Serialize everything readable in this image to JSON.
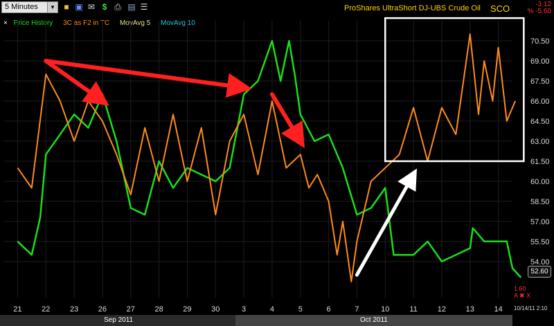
{
  "toolbar": {
    "interval": "5 Minutes",
    "icons": [
      "folder-icon",
      "save-icon",
      "mail-icon",
      "dollar-icon",
      "print-icon",
      "image-icon",
      "options-icon"
    ]
  },
  "header": {
    "title": "ProShares UltraShort DJ-UBS Crude Oil",
    "symbol": "SCO",
    "change": "-3.12",
    "change_pct": "% -5.60"
  },
  "legend": {
    "close": "×",
    "items": [
      {
        "label": "Price History",
        "color": "#19e019"
      },
      {
        "label": "3C as F2 in TC",
        "color": "#ff8c1a"
      },
      {
        "label": "MovAvg 5",
        "color": "#e8e08a"
      },
      {
        "label": "MovAvg 10",
        "color": "#20c8d8"
      }
    ]
  },
  "price_box": "52.60",
  "bottom_info": {
    "value": "1.60",
    "text": "A ✖ X"
  },
  "datestamp": "10/14/11 2:10",
  "months": [
    "Sep 2011",
    "Oct 2011"
  ],
  "colors": {
    "price": "#19e019",
    "indicator": "#ff8c1a",
    "annotation_red": "#ff2020",
    "annotation_white": "#ffffff"
  },
  "chart_data": {
    "type": "line",
    "x_labels": [
      "21",
      "22",
      "23",
      "26",
      "27",
      "28",
      "29",
      "30",
      "3",
      "4",
      "5",
      "6",
      "7",
      "10",
      "11",
      "12",
      "13",
      "14"
    ],
    "y_ticks": [
      "70.50",
      "69.00",
      "67.50",
      "66.00",
      "64.50",
      "63.00",
      "61.50",
      "60.00",
      "58.50",
      "57.00",
      "55.50",
      "54.00"
    ],
    "ylim": [
      51.3,
      72.0
    ],
    "series": [
      {
        "name": "Price History",
        "values": [
          [
            21,
            55.5
          ],
          [
            21.5,
            54.5
          ],
          [
            21.8,
            57.3
          ],
          [
            22,
            62.0
          ],
          [
            22.5,
            63.5
          ],
          [
            23,
            65.0
          ],
          [
            23.5,
            64.0
          ],
          [
            26,
            66.5
          ],
          [
            26.5,
            63.0
          ],
          [
            27,
            58.0
          ],
          [
            27.5,
            57.5
          ],
          [
            28,
            61.5
          ],
          [
            28.5,
            59.5
          ],
          [
            29,
            61.0
          ],
          [
            29.5,
            60.5
          ],
          [
            30,
            60.0
          ],
          [
            30.5,
            61.0
          ],
          [
            3,
            66.5
          ],
          [
            3.5,
            67.5
          ],
          [
            4,
            70.5
          ],
          [
            4.3,
            67.5
          ],
          [
            4.6,
            70.5
          ],
          [
            4.8,
            68.0
          ],
          [
            5,
            65.0
          ],
          [
            5.5,
            63.0
          ],
          [
            6,
            63.5
          ],
          [
            6.5,
            61.0
          ],
          [
            7,
            57.5
          ],
          [
            7.5,
            58.0
          ],
          [
            10,
            59.5
          ],
          [
            10.3,
            54.5
          ],
          [
            10.7,
            54.5
          ],
          [
            11,
            54.5
          ],
          [
            11.5,
            55.5
          ],
          [
            12,
            54.0
          ],
          [
            12.5,
            54.5
          ],
          [
            13,
            55.0
          ],
          [
            13.1,
            56.5
          ],
          [
            13.5,
            55.5
          ],
          [
            14,
            55.5
          ],
          [
            14.3,
            55.5
          ],
          [
            14.5,
            53.5
          ],
          [
            14.8,
            52.8
          ]
        ]
      },
      {
        "name": "3C as F2 in TC",
        "values": [
          [
            21,
            61.0
          ],
          [
            21.5,
            59.5
          ],
          [
            22,
            68.0
          ],
          [
            22.5,
            66.0
          ],
          [
            23,
            63.0
          ],
          [
            23.5,
            66.0
          ],
          [
            26,
            64.5
          ],
          [
            26.5,
            62.0
          ],
          [
            27,
            59.0
          ],
          [
            27.5,
            64.0
          ],
          [
            28,
            60.0
          ],
          [
            28.5,
            65.0
          ],
          [
            29,
            60.0
          ],
          [
            29.5,
            64.0
          ],
          [
            30,
            57.5
          ],
          [
            30.5,
            63.0
          ],
          [
            3,
            65.0
          ],
          [
            3.5,
            60.5
          ],
          [
            4,
            66.0
          ],
          [
            4.5,
            61.0
          ],
          [
            5,
            62.0
          ],
          [
            5.3,
            59.5
          ],
          [
            5.6,
            60.5
          ],
          [
            6,
            58.5
          ],
          [
            6.3,
            54.5
          ],
          [
            6.5,
            57.0
          ],
          [
            6.8,
            52.5
          ],
          [
            7,
            55.5
          ],
          [
            7.5,
            60.0
          ],
          [
            10,
            61.0
          ],
          [
            10.5,
            62.0
          ],
          [
            11,
            65.5
          ],
          [
            11.5,
            61.5
          ],
          [
            12,
            65.5
          ],
          [
            12.5,
            63.5
          ],
          [
            13,
            71.0
          ],
          [
            13.3,
            65.0
          ],
          [
            13.5,
            69.0
          ],
          [
            13.8,
            66.0
          ],
          [
            14,
            70.0
          ],
          [
            14.3,
            64.5
          ],
          [
            14.6,
            66.0
          ]
        ]
      }
    ],
    "annotations": [
      {
        "type": "arrow",
        "color": "red",
        "from": [
          22,
          69.0
        ],
        "to": [
          3,
          67.0
        ]
      },
      {
        "type": "arrow",
        "color": "red",
        "from": [
          22,
          69.0
        ],
        "to": [
          26,
          66.0
        ]
      },
      {
        "type": "arrow",
        "color": "red",
        "from": [
          4,
          66.5
        ],
        "to": [
          5,
          63.0
        ]
      },
      {
        "type": "arrow",
        "color": "white",
        "from": [
          7,
          53.0
        ],
        "to": [
          11,
          60.5
        ]
      },
      {
        "type": "box",
        "color": "white",
        "from": [
          10,
          72.2
        ],
        "to": [
          14.9,
          61.5
        ]
      }
    ],
    "grid": true
  }
}
